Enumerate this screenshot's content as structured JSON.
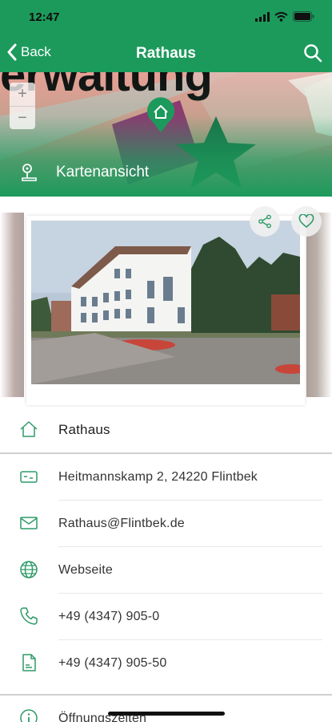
{
  "status_bar": {
    "time": "12:47"
  },
  "nav": {
    "back_label": "Back",
    "title": "Rathaus"
  },
  "map": {
    "background_text": "erwaltung",
    "label": "Kartenansicht",
    "zoom_in": "+",
    "zoom_out": "−"
  },
  "colors": {
    "accent": "#1c9a5c",
    "icon": "#2e9a68"
  },
  "info": {
    "name": "Rathaus",
    "address": "Heitmannskamp 2, 24220 Flintbek",
    "email": "Rathaus@Flintbek.de",
    "website": "Webseite",
    "phone": "+49 (4347) 905-0",
    "fax": "+49 (4347) 905-50",
    "hours": "Öffnungszeiten"
  },
  "icons": {
    "back": "chevron-left-icon",
    "search": "search-icon",
    "share": "share-icon",
    "favorite": "heart-icon",
    "home": "home-icon",
    "address": "address-card-icon",
    "email": "mail-icon",
    "website": "globe-icon",
    "phone": "phone-icon",
    "fax": "document-icon",
    "hours": "info-icon",
    "map": "map-pin-icon"
  }
}
